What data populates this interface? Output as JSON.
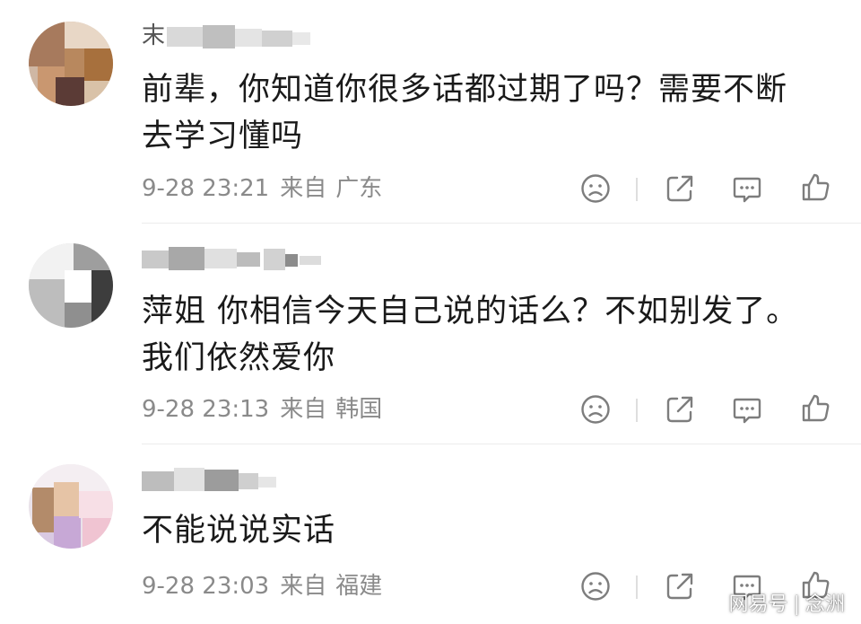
{
  "colors": {
    "text": "#1a1a1a",
    "username": "#555555",
    "meta": "#8a8a8a",
    "icon": "#7d7d7d",
    "divider": "#ececec"
  },
  "comments": [
    {
      "username_visible": "末",
      "text_lines": [
        "前辈，你知道你很多话都过期了吗？需要不断",
        "去学习懂吗"
      ],
      "date": "9-28 23:21",
      "source_prefix": "来自",
      "location": "广东",
      "action_icons": [
        "dislike-face-icon",
        "share-icon",
        "comment-icon",
        "like-thumb-icon"
      ]
    },
    {
      "username_visible": "",
      "text_lines": [
        "萍姐 你相信今天自己说的话么？不如别发了。",
        "我们依然爱你"
      ],
      "date": "9-28 23:13",
      "source_prefix": "来自",
      "location": "韩国",
      "action_icons": [
        "dislike-face-icon",
        "share-icon",
        "comment-icon",
        "like-thumb-icon"
      ]
    },
    {
      "username_visible": "",
      "text_lines": [
        "不能说说实话"
      ],
      "date": "9-28 23:03",
      "source_prefix": "来自",
      "location": "福建",
      "action_icons": [
        "dislike-face-icon",
        "share-icon",
        "comment-icon",
        "like-thumb-icon"
      ]
    }
  ],
  "watermark": {
    "brand": "网易号",
    "author": "念洲"
  }
}
